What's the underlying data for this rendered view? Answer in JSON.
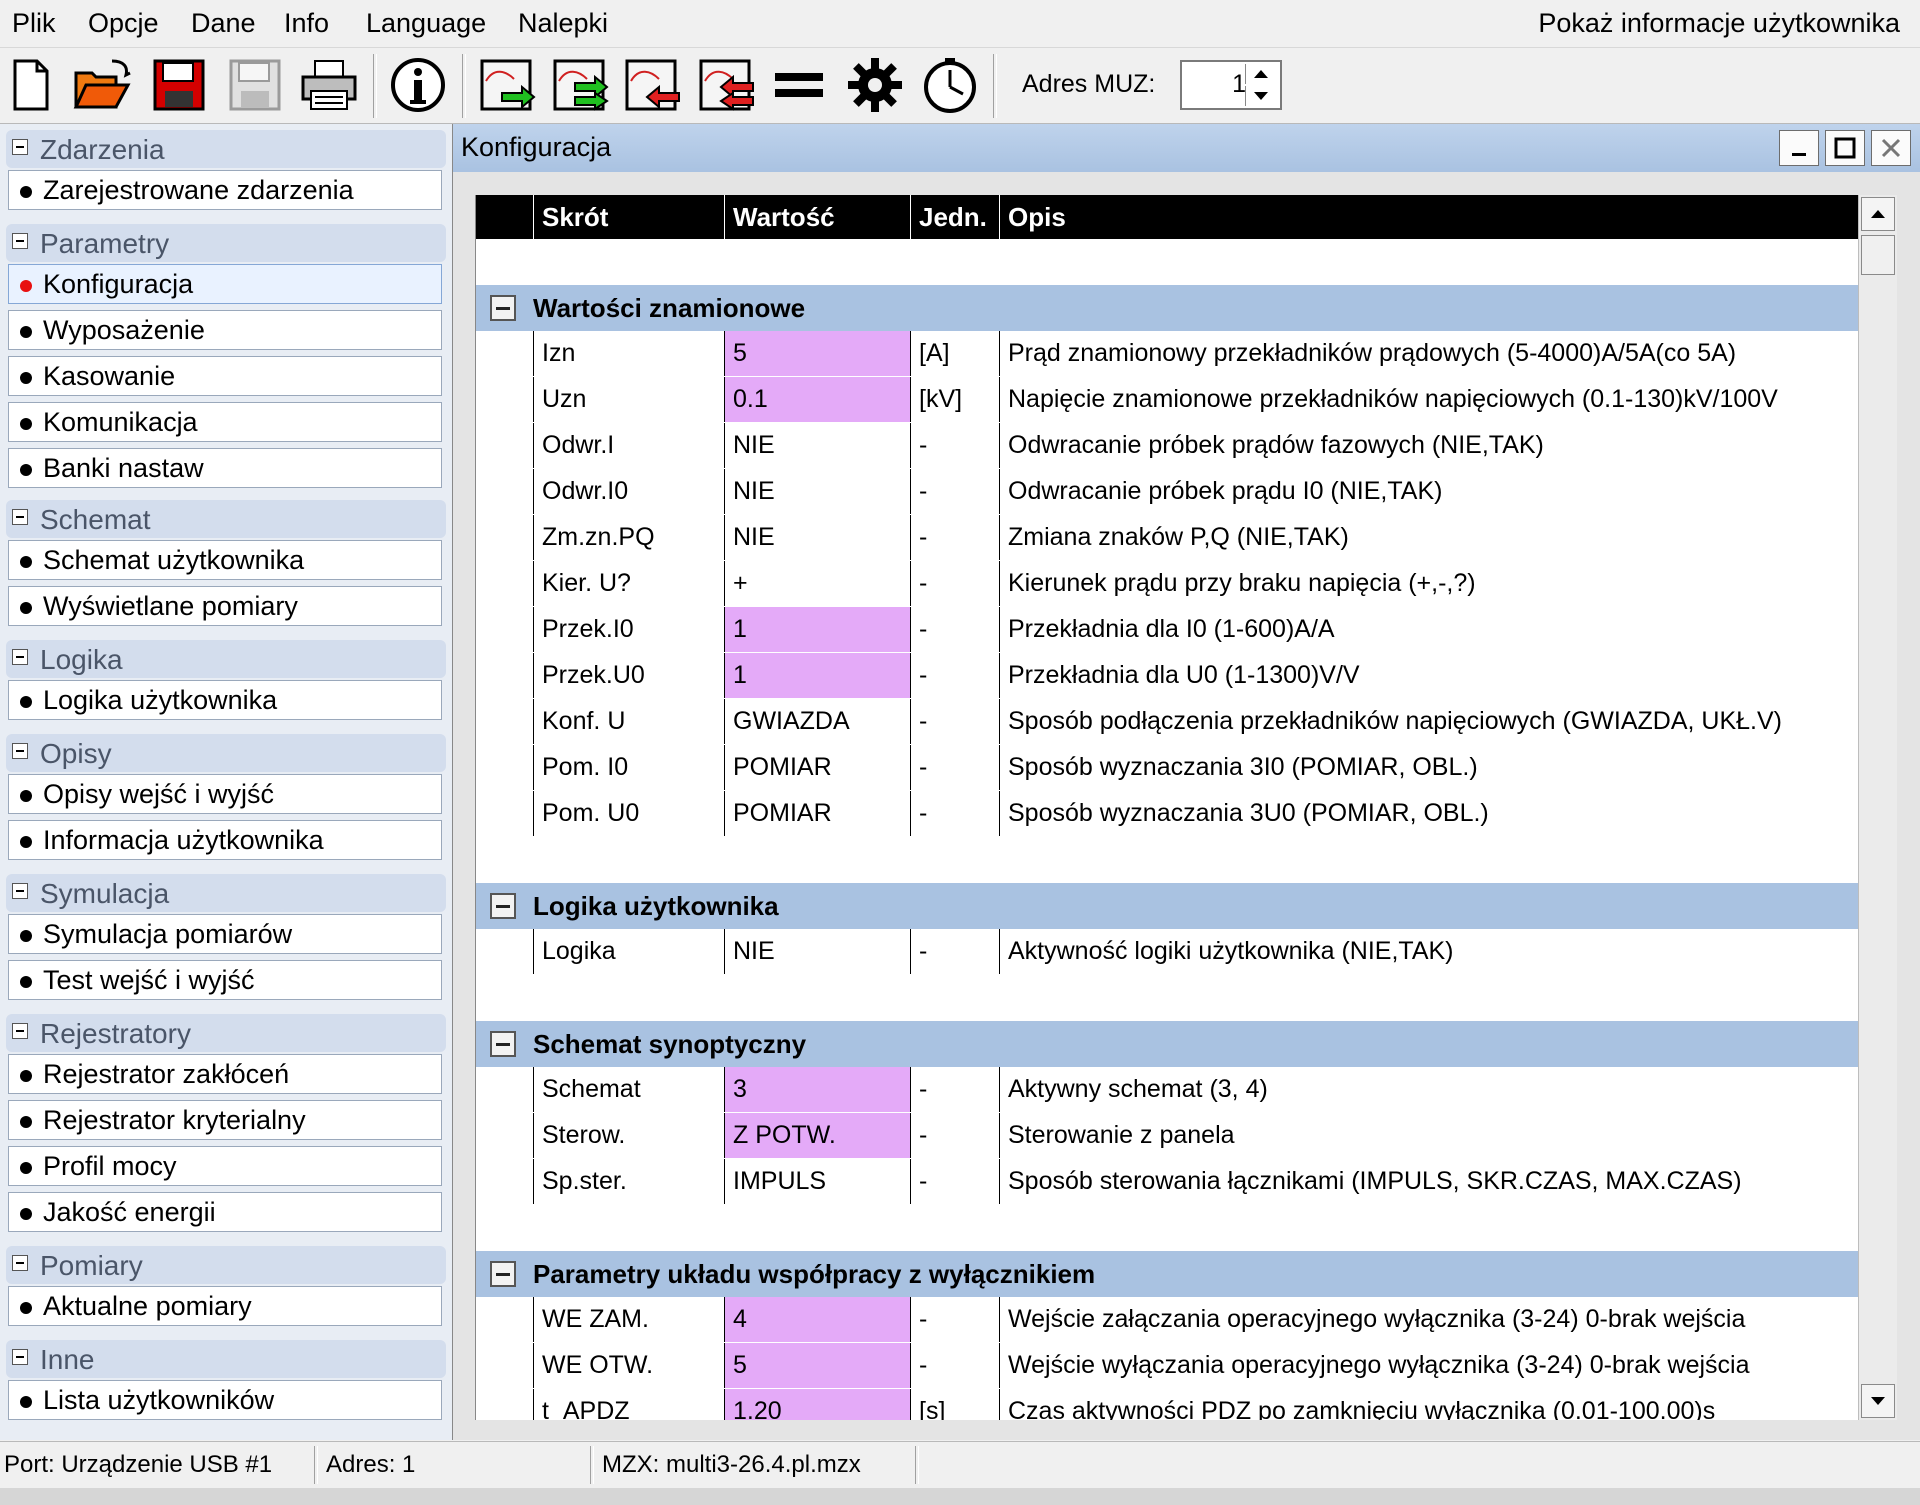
{
  "menu": {
    "items": [
      "Plik",
      "Opcje",
      "Dane",
      "Info",
      "Language",
      "Nalepki"
    ],
    "user_info": "Pokaż informacje użytkownika"
  },
  "toolbar": {
    "icons": [
      "new-file-icon",
      "open-folder-icon",
      "save-icon",
      "save-disabled-icon",
      "print-icon",
      "info-icon",
      "send-icon",
      "send-all-icon",
      "receive-icon",
      "receive-all-icon",
      "equals-icon",
      "settings-gear-icon",
      "clock-icon"
    ],
    "adres_label": "Adres MUZ:",
    "adres_value": "1"
  },
  "sidebar": {
    "groups": [
      {
        "label": "Zdarzenia",
        "items": [
          "Zarejestrowane zdarzenia"
        ]
      },
      {
        "label": "Parametry",
        "items": [
          "Konfiguracja",
          "Wyposażenie",
          "Kasowanie",
          "Komunikacja",
          "Banki nastaw"
        ],
        "active_index": 0
      },
      {
        "label": "Schemat",
        "items": [
          "Schemat użytkownika",
          "Wyświetlane pomiary"
        ]
      },
      {
        "label": "Logika",
        "items": [
          "Logika użytkownika"
        ]
      },
      {
        "label": "Opisy",
        "items": [
          "Opisy wejść i wyjść",
          "Informacja użytkownika"
        ]
      },
      {
        "label": "Symulacja",
        "items": [
          "Symulacja pomiarów",
          "Test wejść i wyjść"
        ]
      },
      {
        "label": "Rejestratory",
        "items": [
          "Rejestrator zakłóceń",
          "Rejestrator kryterialny",
          "Profil mocy",
          "Jakość energii"
        ]
      },
      {
        "label": "Pomiary",
        "items": [
          "Aktualne pomiary"
        ]
      },
      {
        "label": "Inne",
        "items": [
          "Lista użytkowników"
        ]
      }
    ]
  },
  "window": {
    "title": "Konfiguracja"
  },
  "table": {
    "headers": [
      "Skrót",
      "Wartość",
      "Jedn.",
      "Opis"
    ],
    "highlight_color": "#e4aaf8",
    "section_color": "#a9c2e1",
    "sections": [
      {
        "title": "Wartości znamionowe",
        "rows": [
          {
            "skrot": "Izn",
            "wartosc": "5",
            "jedn": "[A]",
            "opis": "Prąd znamionowy przekładników prądowych (5-4000)A/5A(co 5A)",
            "hl": true
          },
          {
            "skrot": "Uzn",
            "wartosc": "0.1",
            "jedn": "[kV]",
            "opis": "Napięcie znamionowe przekładników napięciowych (0.1-130)kV/100V",
            "hl": true
          },
          {
            "skrot": "Odwr.I",
            "wartosc": "NIE",
            "jedn": "-",
            "opis": "Odwracanie próbek prądów fazowych (NIE,TAK)",
            "hl": false
          },
          {
            "skrot": "Odwr.I0",
            "wartosc": "NIE",
            "jedn": "-",
            "opis": "Odwracanie próbek prądu I0 (NIE,TAK)",
            "hl": false
          },
          {
            "skrot": "Zm.zn.PQ",
            "wartosc": "NIE",
            "jedn": "-",
            "opis": "Zmiana znaków P,Q (NIE,TAK)",
            "hl": false
          },
          {
            "skrot": "Kier. U?",
            "wartosc": "+",
            "jedn": "-",
            "opis": "Kierunek prądu przy braku napięcia (+,-,?)",
            "hl": false
          },
          {
            "skrot": "Przek.I0",
            "wartosc": "1",
            "jedn": "-",
            "opis": "Przekładnia dla I0 (1-600)A/A",
            "hl": true
          },
          {
            "skrot": "Przek.U0",
            "wartosc": "1",
            "jedn": "-",
            "opis": "Przekładnia dla U0 (1-1300)V/V",
            "hl": true
          },
          {
            "skrot": "Konf. U",
            "wartosc": "GWIAZDA",
            "jedn": "-",
            "opis": "Sposób podłączenia przekładników napięciowych (GWIAZDA, UKŁ.V)",
            "hl": false
          },
          {
            "skrot": "Pom. I0",
            "wartosc": "POMIAR",
            "jedn": "-",
            "opis": "Sposób wyznaczania 3I0 (POMIAR, OBL.)",
            "hl": false
          },
          {
            "skrot": "Pom. U0",
            "wartosc": "POMIAR",
            "jedn": "-",
            "opis": "Sposób wyznaczania 3U0 (POMIAR, OBL.)",
            "hl": false
          }
        ]
      },
      {
        "title": "Logika użytkownika",
        "rows": [
          {
            "skrot": "Logika",
            "wartosc": "NIE",
            "jedn": "-",
            "opis": "Aktywność logiki użytkownika (NIE,TAK)",
            "hl": false
          }
        ]
      },
      {
        "title": "Schemat synoptyczny",
        "rows": [
          {
            "skrot": "Schemat",
            "wartosc": "3",
            "jedn": "-",
            "opis": "Aktywny schemat (3, 4)",
            "hl": true
          },
          {
            "skrot": "Sterow.",
            "wartosc": "Z POTW.",
            "jedn": "-",
            "opis": "Sterowanie z panela",
            "hl": true
          },
          {
            "skrot": "Sp.ster.",
            "wartosc": "IMPULS",
            "jedn": "-",
            "opis": "Sposób sterowania łącznikami (IMPULS, SKR.CZAS, MAX.CZAS)",
            "hl": false
          }
        ]
      },
      {
        "title": "Parametry układu współpracy z wyłącznikiem",
        "rows": [
          {
            "skrot": "WE ZAM.",
            "wartosc": "4",
            "jedn": "-",
            "opis": "Wejście załączania operacyjnego wyłącznika (3-24) 0-brak wejścia",
            "hl": true
          },
          {
            "skrot": "WE OTW.",
            "wartosc": "5",
            "jedn": "-",
            "opis": "Wejście wyłączania operacyjnego wyłącznika (3-24) 0-brak wejścia",
            "hl": true
          },
          {
            "skrot": "t_APDZ",
            "wartosc": "1.20",
            "jedn": "[s]",
            "opis": "Czas aktywności PDZ po zamknięciu wyłącznika (0.01-100.00)s",
            "hl": true
          }
        ]
      }
    ]
  },
  "status": {
    "port": "Port: Urządzenie USB #1",
    "adres": "Adres: 1",
    "mzx": "MZX: multi3-26.4.pl.mzx"
  }
}
